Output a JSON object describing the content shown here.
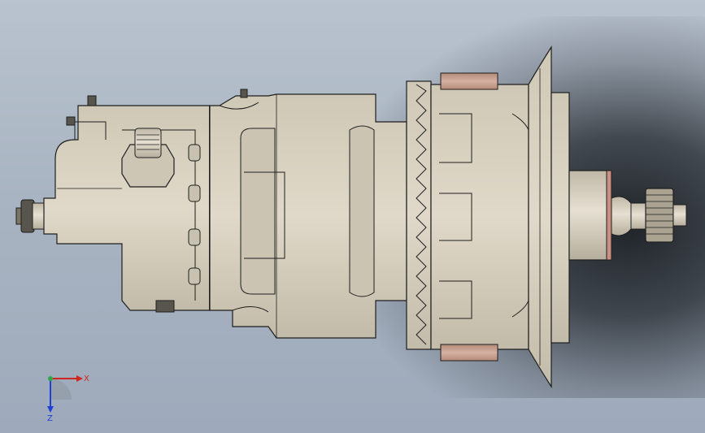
{
  "viewport": {
    "background_top": "#b9c3cf",
    "background_bottom": "#9eaabb"
  },
  "model": {
    "body_color": "#d9d2c2",
    "body_shade": "#bdb6a5",
    "edge_color": "#1e1e1e",
    "bearing_pad_color": "#c9a596"
  },
  "triad": {
    "x_label": "X",
    "z_label": "Z",
    "x_color": "#d0261f",
    "y_color": "#2ea84a",
    "z_color": "#1f3fd6"
  }
}
